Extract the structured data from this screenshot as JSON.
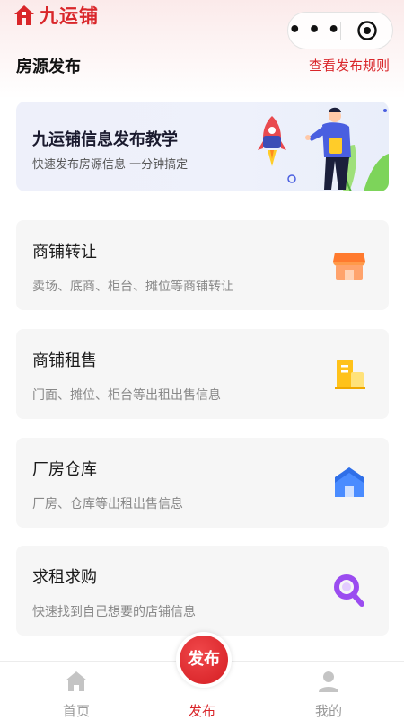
{
  "app": {
    "brand_name": "九运铺",
    "brand_color": "#d9262a"
  },
  "header": {
    "title": "房源发布",
    "rules_link": "查看发布规则",
    "capsule_more_icon": "more-dots-icon",
    "capsule_close_icon": "target-close-icon"
  },
  "banner": {
    "title": "九运铺信息发布教学",
    "subtitle": "快速发布房源信息 一分钟搞定"
  },
  "categories": [
    {
      "title": "商铺转让",
      "desc": "卖场、底商、柜台、摊位等商铺转让",
      "icon": "shop-icon"
    },
    {
      "title": "商铺租售",
      "desc": "门面、摊位、柜台等出租出售信息",
      "icon": "building-icon"
    },
    {
      "title": "厂房仓库",
      "desc": "厂房、仓库等出租出售信息",
      "icon": "warehouse-icon"
    },
    {
      "title": "求租求购",
      "desc": "快速找到自己想要的店铺信息",
      "icon": "search-icon"
    }
  ],
  "tabbar": {
    "home": "首页",
    "publish": "发布",
    "publish_button": "发布",
    "mine": "我的"
  }
}
